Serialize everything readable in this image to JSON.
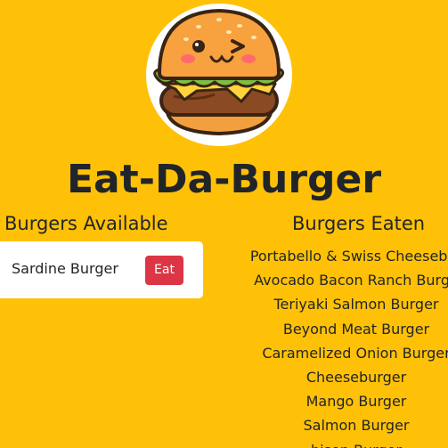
{
  "header": {
    "logo_icon": "burger-mascot-icon",
    "title": "Eat-Da-Burger"
  },
  "available": {
    "heading": "Burgers Available",
    "items": [
      {
        "name": "Sardine Burger",
        "button_label": "Eat"
      }
    ]
  },
  "eaten": {
    "heading": "Burgers Eaten",
    "items": [
      "Portabello & Swiss Cheesebur",
      "Avocado Bacon Ranch Burge",
      "Teriyaki Salmon Burger",
      "Beyond Meat Burger",
      "Caramelized Onion Burger",
      "Cheeseburger",
      "Mango Burger",
      "Salmon Burger",
      "bison Burger"
    ]
  },
  "colors": {
    "background": "#ffc107",
    "button": "#dc3545",
    "text": "#212529"
  }
}
